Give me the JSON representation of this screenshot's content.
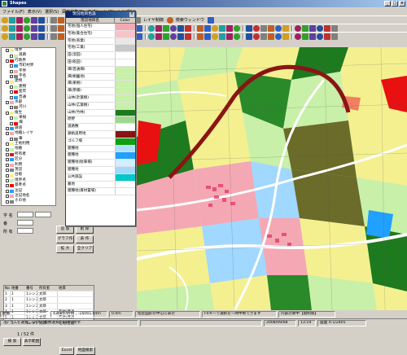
{
  "window": {
    "title": "Shapes"
  },
  "menu": [
    "ファイル(F)",
    "表示(V)",
    "選択(S)",
    "図形編集(E)",
    "オプション(O)",
    "ヘルプ(H)"
  ],
  "toolbar": {
    "label_a": "描画",
    "label_b": "レイヤ制御",
    "label_c": "検索ウィンドウ"
  },
  "layers": [
    {
      "label": "境界",
      "indent": 1
    },
    {
      "label": "道路",
      "indent": 2
    },
    {
      "label": "行政界",
      "indent": 1
    },
    {
      "label": "市町村界",
      "indent": 2
    },
    {
      "label": "字界",
      "indent": 2
    },
    {
      "label": "字名",
      "indent": 2
    },
    {
      "label": "建物",
      "indent": 1
    },
    {
      "label": "建物",
      "indent": 2
    },
    {
      "label": "堅牢",
      "indent": 2
    },
    {
      "label": "普通",
      "indent": 2
    },
    {
      "label": "水部",
      "indent": 1
    },
    {
      "label": "河川",
      "indent": 2
    },
    {
      "label": "植生",
      "indent": 1
    },
    {
      "label": "果樹",
      "indent": 2
    },
    {
      "label": "畑",
      "indent": 2
    },
    {
      "label": "鉄道",
      "indent": 1
    },
    {
      "label": "地籍レイヤ",
      "indent": 1
    },
    {
      "label": "筆",
      "indent": 2
    },
    {
      "label": "土地利用",
      "indent": 1
    },
    {
      "label": "地番",
      "indent": 1
    },
    {
      "label": "所有者",
      "indent": 1
    },
    {
      "label": "区分",
      "indent": 1
    },
    {
      "label": "利用",
      "indent": 1
    },
    {
      "label": "現況",
      "indent": 1
    },
    {
      "label": "台帳",
      "indent": 1
    },
    {
      "label": "境界点",
      "indent": 1
    },
    {
      "label": "基準点",
      "indent": 1
    },
    {
      "label": "注記",
      "indent": 1
    },
    {
      "label": "注記地名",
      "indent": 1
    },
    {
      "label": "その他",
      "indent": 1
    }
  ],
  "legend": {
    "title": "現況地目色設",
    "col_name": "現況地目名",
    "col_color": "Color",
    "items": [
      {
        "name": "宅地(個人住宅)",
        "color": "#f4a8b4"
      },
      {
        "name": "宅地(集合住宅)",
        "color": "#f7c4cc"
      },
      {
        "name": "宅地(商業)",
        "color": "#e8e8e8"
      },
      {
        "name": "宅地(工業)",
        "color": "#c8c8c8"
      },
      {
        "name": "田(湿田)",
        "color": "#ffffff"
      },
      {
        "name": "田(乾田)",
        "color": "#ffffff"
      },
      {
        "name": "畑(普通畑)",
        "color": "#c8f0a8"
      },
      {
        "name": "畑(樹園地)",
        "color": "#c8f0a8"
      },
      {
        "name": "畑(果樹)",
        "color": "#c8f0a8"
      },
      {
        "name": "畑(茶畑)",
        "color": "#c8f0a8"
      },
      {
        "name": "山林(針葉樹)",
        "color": "#c8f0a8"
      },
      {
        "name": "山林(広葉樹)",
        "color": "#c8f0a8"
      },
      {
        "name": "山林(竹林)",
        "color": "#1e7a1e"
      },
      {
        "name": "原野",
        "color": "#a0d890"
      },
      {
        "name": "道路敷",
        "color": "#ffffff"
      },
      {
        "name": "鉄軌道用地",
        "color": "#8a1414"
      },
      {
        "name": "ゴルフ場",
        "color": "#10a010"
      },
      {
        "name": "雑種地",
        "color": "#b0e0ff"
      },
      {
        "name": "雑種地",
        "color": "#20a0ff"
      },
      {
        "name": "雑種地(駐車場)",
        "color": "#d0f0ff"
      },
      {
        "name": "雑種地",
        "color": "#a0d8ff"
      },
      {
        "name": "公共施設",
        "color": "#00c8c8"
      },
      {
        "name": "墓地",
        "color": "#ffffff"
      },
      {
        "name": "雑種地(資材置場)",
        "color": "#ffffff"
      }
    ]
  },
  "props": {
    "label_a": "字 名",
    "label_b": "番",
    "label_c": "所 有",
    "btn_add": "追 加",
    "btn_delete": "削 除",
    "btn_graph": "グラフ作",
    "btn_table": "表 作",
    "btn_zoom": "拡 大",
    "btn_clear": "全クリア",
    "btn_search": "検 索",
    "btn_change": "表示範囲",
    "btn_excel": "Excel",
    "btn_map": "地図検索",
    "record": "1 / 52 件",
    "grid_head": [
      "No",
      "地番",
      "番号",
      "所有者",
      "地目"
    ],
    "grid_rows": [
      [
        "1",
        "1",
        "1シンス",
        "太郎",
        ""
      ],
      [
        "2",
        "1",
        "1シンス",
        "太郎",
        ""
      ],
      [
        "3",
        "1",
        "1シンス",
        "太郎",
        ""
      ],
      [
        "4",
        "1",
        "1シンス",
        "太郎",
        "宅地(普通"
      ],
      [
        "5",
        "1",
        "1シンス",
        "太郎",
        "宅地(普通"
      ],
      [
        "6",
        "1",
        "1シンス",
        "太郎",
        "宅地(普通"
      ]
    ]
  },
  "status": {
    "layer": "地番",
    "coords": "43685.97m , -16065.04m",
    "scale": "0.0m",
    "msg": "指定図形の中心に表示",
    "hint": "F4キーで選択を一時中断できます",
    "mode": "内部計算中【無制限】",
    "date": "2008/09/08",
    "time": "13:19",
    "footer_left": "アイテムを選択。Shiftで複数選択。Ctrlで文字",
    "footer_right": "画面 X:1/2405"
  }
}
